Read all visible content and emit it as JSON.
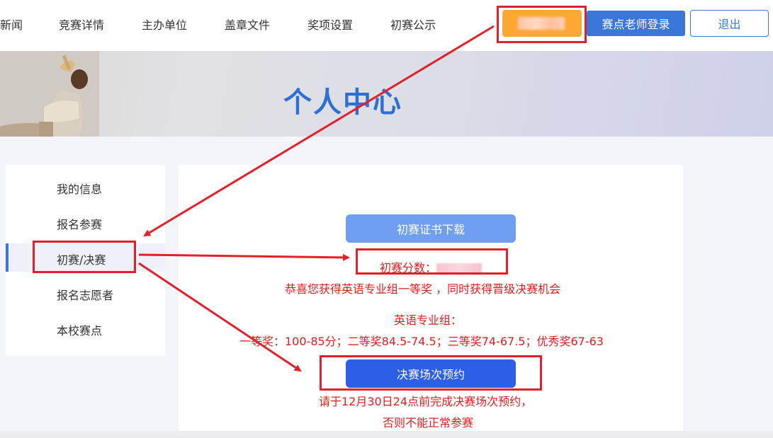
{
  "nav": {
    "items": [
      "新闻",
      "竞赛详情",
      "主办单位",
      "盖章文件",
      "奖项设置",
      "初赛公示"
    ],
    "teacher_login": "赛点老师登录",
    "logout": "退出"
  },
  "banner": {
    "title": "个人中心"
  },
  "sidebar": {
    "items": [
      {
        "label": "我的信息"
      },
      {
        "label": "报名参赛"
      },
      {
        "label": "初赛/决赛"
      },
      {
        "label": "报名志愿者"
      },
      {
        "label": "本校赛点"
      }
    ],
    "active_index": 2
  },
  "main": {
    "cert_button": "初赛证书下载",
    "score_label": "初赛分数：",
    "congrats": "恭喜您获得英语专业组一等奖 ，同时获得晋级决赛机会",
    "group_title": "英语专业组：",
    "award_ranges": "一等奖：100-85分；二等奖84.5-74.5；三等奖74-67.5；优秀奖67-63",
    "final_button": "决赛场次预约",
    "deadline_line1": "请于12月30日24点前完成决赛场次预约，",
    "deadline_line2": "否则不能正常参赛"
  },
  "colors": {
    "accent_blue": "#3a77d8",
    "user_button_orange": "#ffa733",
    "annotation_red": "#e0202a",
    "text_red": "#e11d1d"
  }
}
